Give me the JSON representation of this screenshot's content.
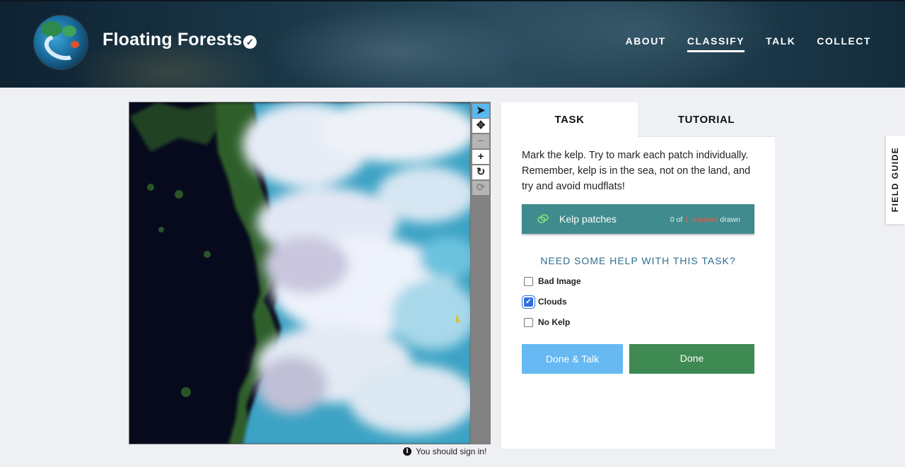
{
  "header": {
    "title": "Floating Forests",
    "nav": [
      {
        "label": "ABOUT",
        "active": false
      },
      {
        "label": "CLASSIFY",
        "active": true
      },
      {
        "label": "TALK",
        "active": false
      },
      {
        "label": "COLLECT",
        "active": false
      }
    ]
  },
  "viewer": {
    "tools": [
      "pointer-icon",
      "move-icon",
      "zoom-out-icon",
      "zoom-in-icon",
      "rotate-icon",
      "reset-icon"
    ],
    "signin_notice": "You should sign in!"
  },
  "panel": {
    "tabs": {
      "task": "TASK",
      "tutorial": "TUTORIAL"
    },
    "instructions": "Mark the kelp. Try to mark each patch individually. Remember, kelp is in the sea, not on the land, and try and avoid mudflats!",
    "tool": {
      "label": "Kelp patches",
      "count_prefix": "0 of",
      "count_required": "1 required",
      "count_suffix": "drawn",
      "color": "#3f8b8e"
    },
    "help_heading": "NEED SOME HELP WITH THIS TASK?",
    "checkboxes": [
      {
        "label": "Bad Image",
        "checked": false
      },
      {
        "label": "Clouds",
        "checked": true
      },
      {
        "label": "No Kelp",
        "checked": false
      }
    ],
    "buttons": {
      "done_talk": "Done & Talk",
      "done": "Done"
    }
  },
  "field_guide": "FIELD GUIDE",
  "colors": {
    "talk_button": "#66b9f2",
    "done_button": "#3f8a52",
    "accent_blue": "#5ab8f0"
  }
}
